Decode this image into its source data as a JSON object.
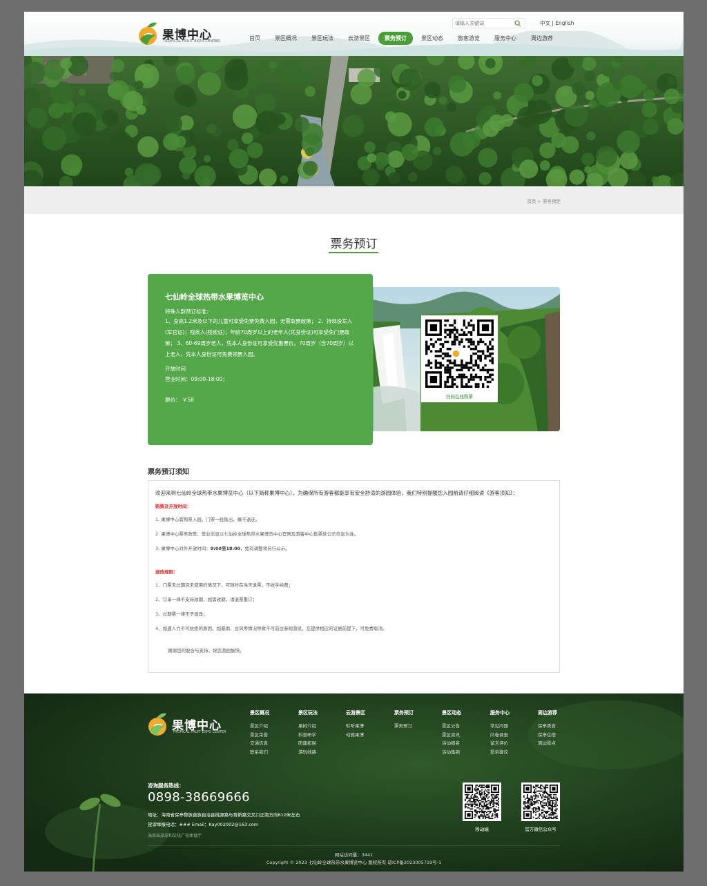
{
  "header": {
    "logo_cn": "果博中心",
    "logo_en": "TROPICAL FRUIT EXPO CENTER",
    "search_placeholder": "请输入关键词",
    "lang_cn": "中文",
    "lang_sep": "|",
    "lang_en": "English",
    "nav": [
      {
        "label": "首页"
      },
      {
        "label": "景区概况"
      },
      {
        "label": "景区玩法"
      },
      {
        "label": "云游景区"
      },
      {
        "label": "票务预订"
      },
      {
        "label": "景区动态"
      },
      {
        "label": "旅客游览"
      },
      {
        "label": "服务中心"
      },
      {
        "label": "周边游荐"
      }
    ],
    "active_nav_index": 4
  },
  "breadcrumb": {
    "home": "首页",
    "sep": ">",
    "current": "票务预定"
  },
  "page_title": "票务预订",
  "ticket": {
    "name": "七仙岭全球热带水果博览中心",
    "policy_label": "特殊人群预订标准：",
    "policy": "1、身高1.2米及以下的儿童可享受免票免费入园，无需取票政策；  2、持现役军人(军官证)；残疾人(残疾证)；年龄70周岁以上的老年人(凭身份证)可享受免门票政策；  3、60-69周岁老人，凭本人身份证可享受优惠票价。70周岁（含70周岁）以上老人，凭本人身份证可免费领票入园。",
    "hours_label": "开放时间",
    "hours": "营业时间：09:00-18:00；",
    "price": "票价：  ￥58",
    "qr_caption": "扫码在线购票"
  },
  "notice": {
    "title": "票务预订须知",
    "intro": "欢迎来到七仙岭全球热带水果博览中心（以下简称果博中心）。为确保所有游客都能享有安全舒适的游园体验，我们特别提醒您入园前请仔细阅读《游客须知》：",
    "section1_title": "购票及开放时间：",
    "section1_items": [
      "1. 果博中心需购票入园，门票一经售出，概不退还。",
      "2. 果博中心票务政策、营业信息以七仙岭全球热带水果博览中心官网及游客中心售票处公示信息为准。"
    ],
    "item3_pre": "3. 果博中心对外开放时间：",
    "item3_bold": "9:00至18:00",
    "item3_post": "，如有调整将另行公示。",
    "section2_title": "退改规则：",
    "section2_items": [
      "1、门票未过期且未使用的情况下，可随时在当天退票，不收手续费；",
      "2、订单一律不支持改期，如需改期，请退票重订；",
      "3、过期票一律不予退改；",
      "4、如遇人力不可抗拒的原因，如暴雨、台风等情况导致不可前往参观游览，在提供相应的证据前提下，可免费取消。"
    ],
    "thanks": "谢谢您的配合与支持，祝您游园愉快。"
  },
  "footer": {
    "logo_cn": "果博中心",
    "logo_en": "TROPICAL FRUIT EXPO CENTER",
    "columns": [
      {
        "head": "景区概况",
        "links": [
          "景区介绍",
          "景区荣誉",
          "交通信息",
          "联系我们"
        ]
      },
      {
        "head": "景区玩法",
        "links": [
          "果树介绍",
          "科普研学",
          "团建拓展",
          "游玩线路"
        ]
      },
      {
        "head": "云游景区",
        "links": [
          "聆听果博",
          "动感果博"
        ]
      },
      {
        "head": "票务预订",
        "links": [
          "票务预订"
        ]
      },
      {
        "head": "景区动态",
        "links": [
          "景区公告",
          "景区资讯",
          "活动报名",
          "活动集锦"
        ]
      },
      {
        "head": "服务中心",
        "links": [
          "常见问题",
          "问卷调查",
          "留言评价",
          "投诉建议"
        ]
      },
      {
        "head": "周边游荐",
        "links": [
          "保亭美食",
          "保亭住宿",
          "周边景点"
        ]
      }
    ],
    "hotline_label": "咨询服务热线：",
    "hotline": "0898-38669666",
    "address": "地址：海南省保亭黎族苗族自治县桃源路与育新路交叉口正南方向610米左右",
    "email": "投诉举报电话：### Email：Kay002002@163.com",
    "authority": "海南省旅游和文化广电体育厅",
    "qr1_caption": "移动端",
    "qr2_caption": "官方微信公众号",
    "visits": "网站访问量：3441",
    "copyright": "Copyright © 2023 七仙岭全球热带水果博览中心 版权所有 琼ICP备2023005719号-1"
  },
  "colors": {
    "accent": "#4a9e37",
    "card": "#54a84a",
    "notice_red": "#e32525",
    "footer_bg": "#1d3b1b"
  },
  "icons": [
    "logo-mark-icon",
    "search-icon",
    "qr-code-icon"
  ]
}
